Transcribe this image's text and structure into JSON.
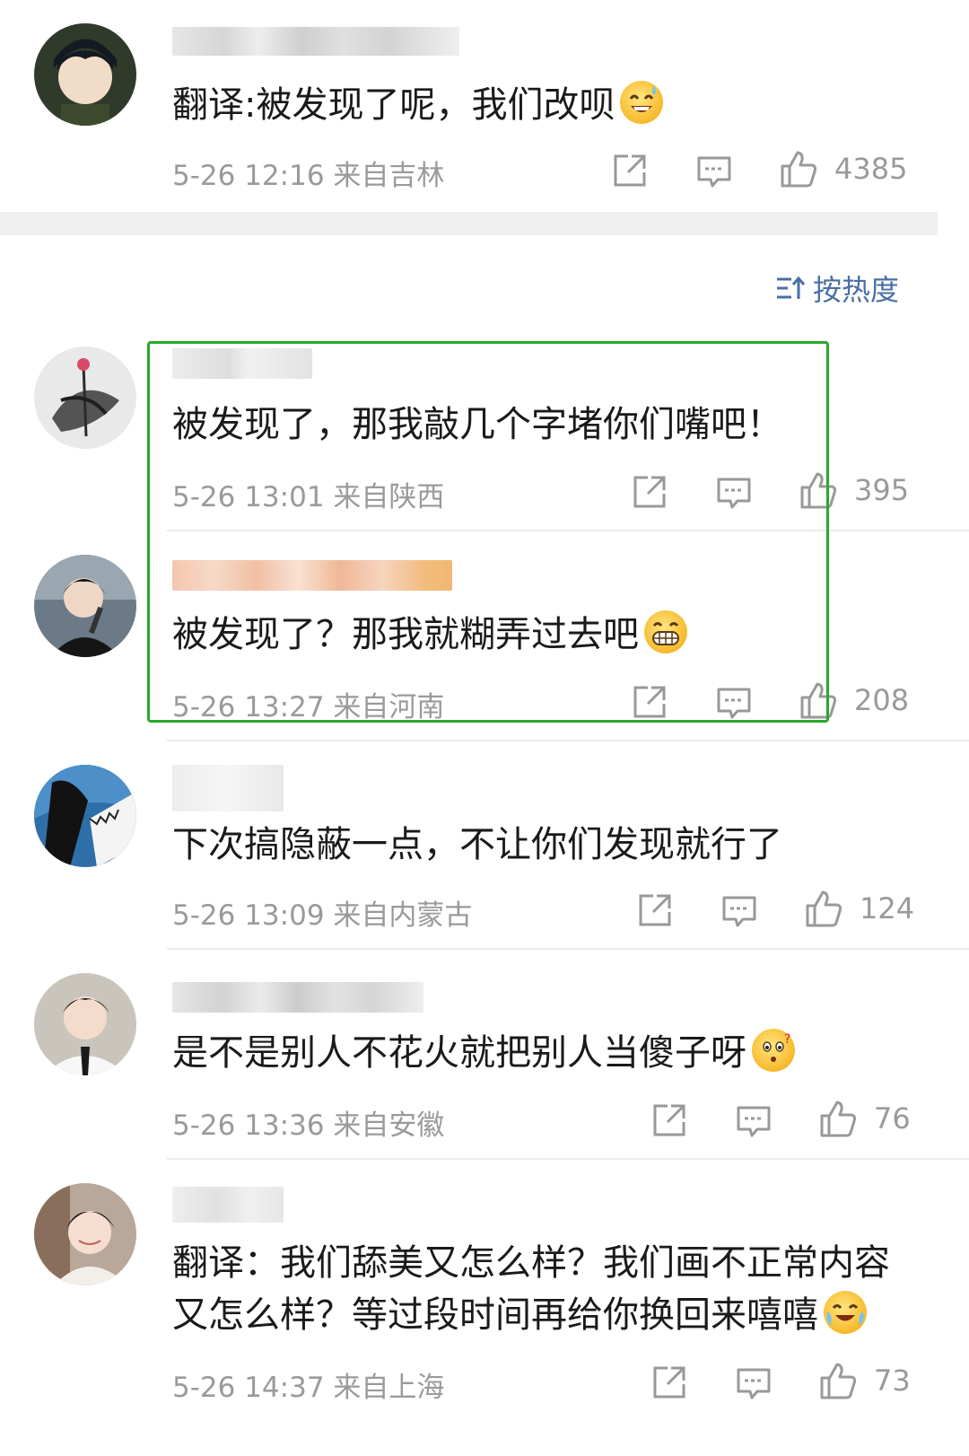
{
  "sort": {
    "label": "按热度"
  },
  "top_comment": {
    "text": "翻译:被发现了呢，我们改呗",
    "meta": "5-26 12:16 来自吉林",
    "likes": "4385"
  },
  "comments": [
    {
      "text": "被发现了，那我敲几个字堵你们嘴吧！",
      "meta": "5-26 13:01 来自陕西",
      "likes": "395"
    },
    {
      "text": "被发现了？那我就糊弄过去吧",
      "meta": "5-26 13:27 来自河南",
      "likes": "208"
    },
    {
      "text": "下次搞隐蔽一点，不让你们发现就行了",
      "meta": "5-26 13:09 来自内蒙古",
      "likes": "124"
    },
    {
      "text": "是不是别人不花火就把别人当傻子呀",
      "meta": "5-26 13:36 来自安徽",
      "likes": "76"
    },
    {
      "text_line1": "翻译：我们舔美又怎么样？我们画不正常内容",
      "text_line2": "又怎么样？等过段时间再给你换回来嘻嘻",
      "meta": "5-26 14:37 来自上海",
      "likes": "73"
    }
  ],
  "colors": {
    "highlight_box": "#2aa82a",
    "sort_label": "#4a6fa5",
    "meta": "#9a9a9a",
    "separator": "#eeeeee"
  },
  "icons": [
    "share-icon",
    "comment-icon",
    "like-icon",
    "sort-icon"
  ]
}
